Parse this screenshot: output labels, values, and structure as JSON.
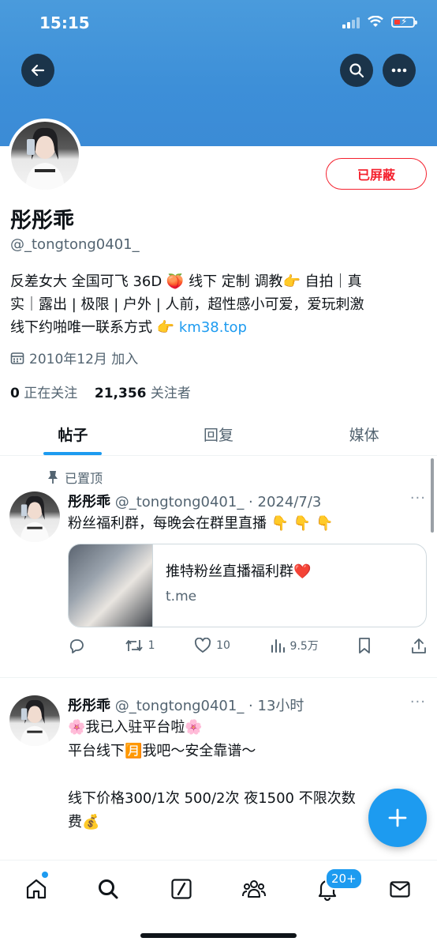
{
  "status_bar": {
    "time": "15:15"
  },
  "profile": {
    "name": "彤彤乖",
    "handle": "@_tongtong0401_",
    "blocked_label": "已屏蔽",
    "bio_line1": "反差女大 全国可飞 36D 🍑 线下 定制 调教👉 自拍｜真",
    "bio_line2": "实｜露出 | 极限 | 户外 | 人前，超性感小可爱，爱玩刺激",
    "bio_line3": "线下约啪唯一联系方式 👉 ",
    "bio_link": "km38.top",
    "joined": "2010年12月 加入",
    "following_count": "0",
    "following_label": " 正在关注",
    "followers_count": "21,356",
    "followers_label": " 关注者"
  },
  "tabs": [
    {
      "label": "帖子"
    },
    {
      "label": "回复"
    },
    {
      "label": "媒体"
    }
  ],
  "tweets": [
    {
      "pinned_label": "已置顶",
      "name": "彤彤乖",
      "handle_date": " @_tongtong0401_ · 2024/7/3",
      "text": "粉丝福利群，每晚会在群里直播 👇 👇 👇",
      "card_title": "推特粉丝直播福利群❤️",
      "card_domain": "t.me",
      "retweets": "1",
      "likes": "10",
      "views": "9.5万"
    },
    {
      "name": "彤彤乖",
      "handle_date": " @_tongtong0401_ · 13小时",
      "line1": "🌸我已入驻平台啦🌸",
      "line2": "平台线下🈷️我吧～安全靠谱～",
      "line3": "线下价格300/1次  500/2次  夜1500 不限次数",
      "line4": "费💰"
    }
  ],
  "bottom_nav": {
    "notifications_badge": "20+"
  },
  "icons": [
    "back-arrow-icon",
    "search-icon",
    "more-icon",
    "calendar-icon",
    "pin-icon",
    "reply-icon",
    "retweet-icon",
    "like-icon",
    "views-icon",
    "bookmark-icon",
    "share-icon",
    "compose-icon",
    "home-icon",
    "explore-icon",
    "grok-icon",
    "communities-icon",
    "bell-icon",
    "mail-icon"
  ],
  "colors": {
    "accent": "#1d9bf0",
    "danger": "#f4212e",
    "banner": "#3d8fd8"
  }
}
